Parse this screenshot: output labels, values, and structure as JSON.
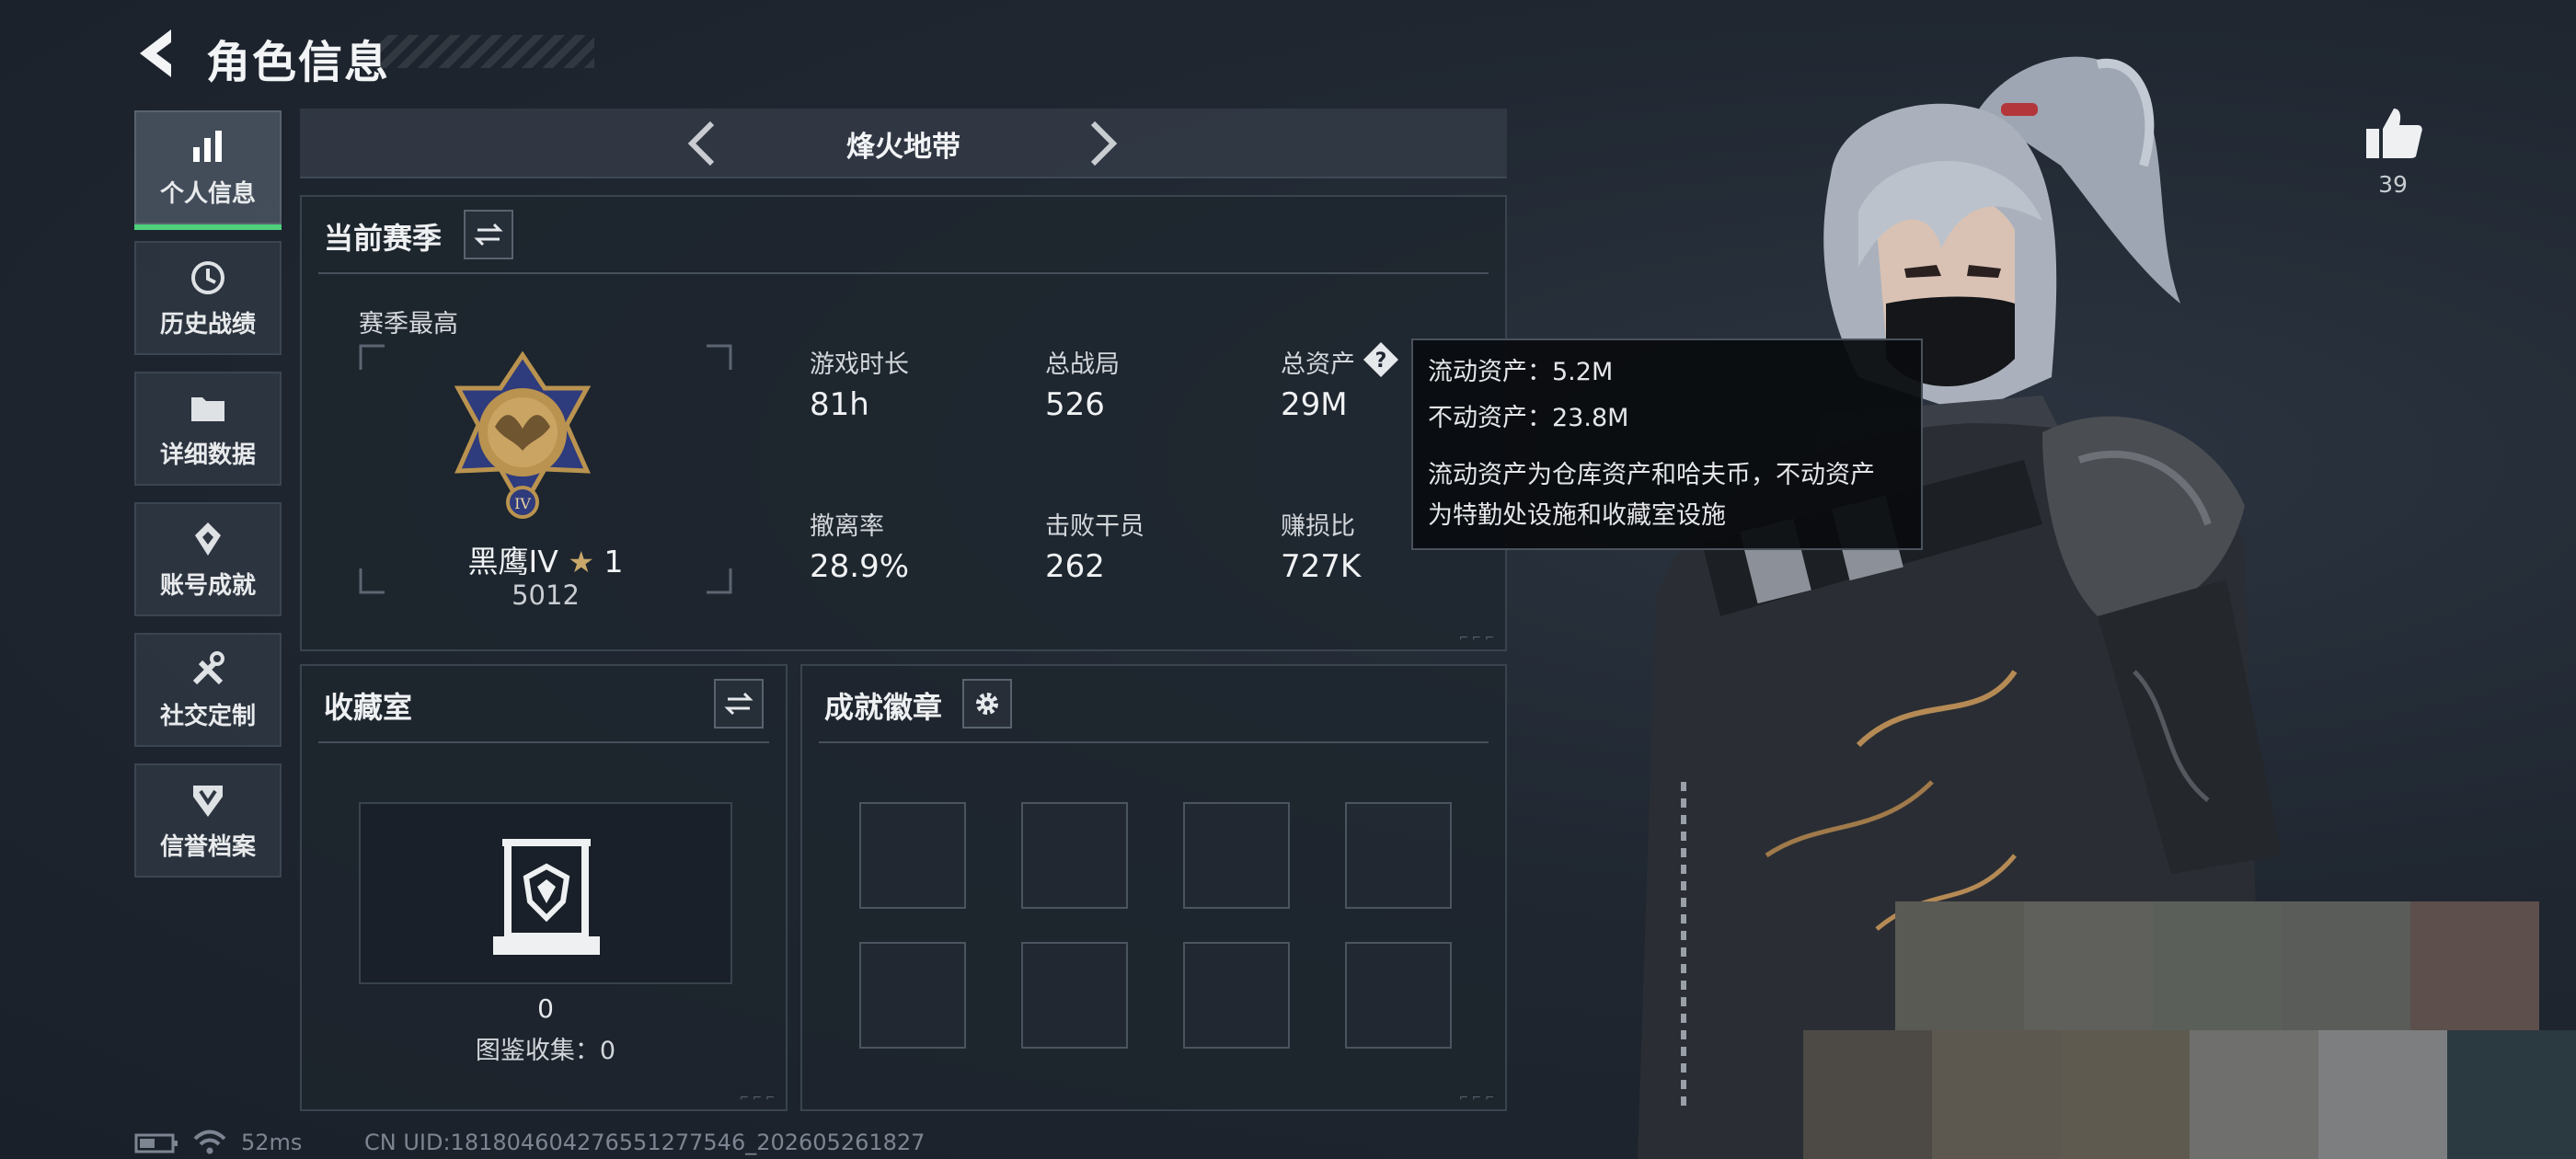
{
  "header": {
    "title": "角色信息"
  },
  "sidebar": {
    "items": [
      {
        "label": "个人信息",
        "icon": "bar-chart-icon",
        "active": true
      },
      {
        "label": "历史战绩",
        "icon": "history-icon",
        "active": false
      },
      {
        "label": "详细数据",
        "icon": "folder-icon",
        "active": false
      },
      {
        "label": "账号成就",
        "icon": "achievement-icon",
        "active": false
      },
      {
        "label": "社交定制",
        "icon": "tools-icon",
        "active": false
      },
      {
        "label": "信誉档案",
        "icon": "shield-icon",
        "active": false
      }
    ]
  },
  "mode": {
    "title": "烽火地带"
  },
  "season": {
    "title": "当前赛季",
    "best_label": "赛季最高",
    "rank_name": "黑鹰IV",
    "rank_stars": "1",
    "rank_score": "5012",
    "stats": [
      {
        "label": "游戏时长",
        "value": "81h"
      },
      {
        "label": "总战局",
        "value": "526"
      },
      {
        "label": "总资产",
        "value": "29M"
      },
      {
        "label": "撤离率",
        "value": "28.9%"
      },
      {
        "label": "击败干员",
        "value": "262"
      },
      {
        "label": "赚损比",
        "value": "727K"
      }
    ]
  },
  "tooltip": {
    "liquid": "流动资产：5.2M",
    "fixed": "不动资产：23.8M",
    "desc_line1": "流动资产为仓库资产和哈夫币，不动资产",
    "desc_line2": "为特勤处设施和收藏室设施"
  },
  "collection": {
    "title": "收藏室",
    "count": "0",
    "catalog": "图鉴收集：0"
  },
  "achievements": {
    "title": "成就徽章"
  },
  "status": {
    "ping": "52ms",
    "uid": "CN UID:1818046042765512775​46_202605261827"
  },
  "likes": {
    "count": "39"
  },
  "colors": {
    "accent_green": "#4fd07d",
    "panel_border": "#3a444f",
    "background": "#1e2530"
  }
}
